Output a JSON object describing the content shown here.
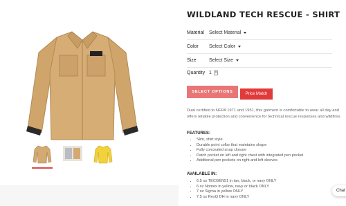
{
  "product": {
    "title": "WILDLAND TECH RESCUE - SHIRT",
    "options": [
      {
        "label": "Material",
        "value": "Select Material"
      },
      {
        "label": "Color",
        "value": "Select Color"
      },
      {
        "label": "Size",
        "value": "Select Size"
      }
    ],
    "quantity": {
      "label": "Quantity",
      "value": "1"
    },
    "select_button": "SELECT OPTIONS",
    "price_button": "Price Match",
    "description": "Dual certified to NFPA 1971 and 1951, this garment is comfortable to wear all day and offers reliable protection and convenience for technical rescue responses and wildfires.",
    "features_heading": "FEATURES:",
    "features": [
      "Slim, shirt style",
      "Durable point collar that maintains shape",
      "Fully concealed snap closure",
      "Patch pocket on left and right chest with integrated pen pocket",
      "Additional pen pockets on right and left sleeves"
    ],
    "available_heading": "AVAILABLE IN:",
    "available": [
      "6.5 oz TECGEN51 in tan, black, or navy ONLY",
      "6 oz Nomex in yellow, navy or black ONLY",
      "7 oz Sigma in yellow ONLY",
      "7.5 oz ResQ DH in navy ONLY"
    ],
    "shirt_tag": "TECGEN",
    "colors": {
      "tan": "#d4aa72",
      "red": "#e04848",
      "button": "#e97676",
      "price": "#e23a3a"
    }
  },
  "chat": {
    "label": "Chat"
  }
}
